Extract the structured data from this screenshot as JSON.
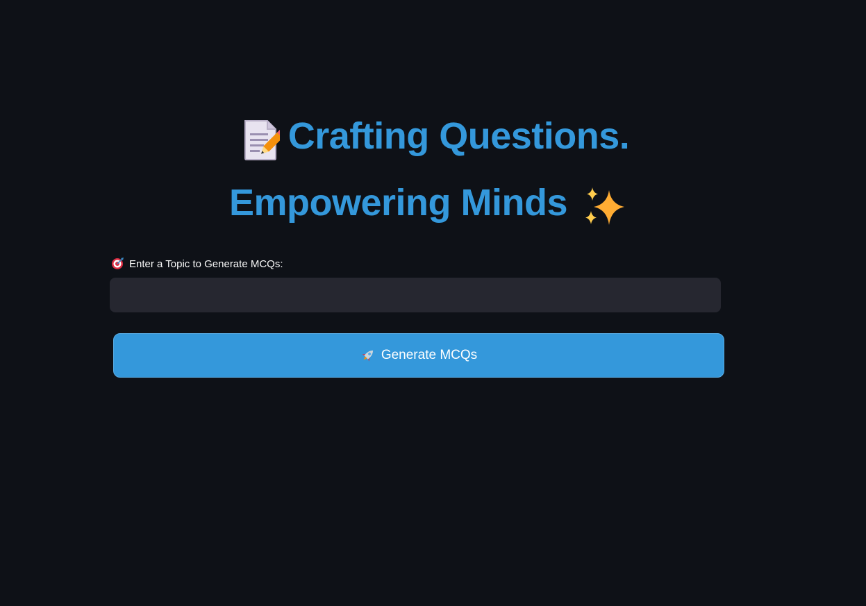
{
  "title": {
    "line1": "Crafting Questions.",
    "line2": "Empowering Minds",
    "line1_icon": "memo-icon",
    "line2_icon": "sparkles-icon",
    "color": "#3498db"
  },
  "topic_input": {
    "label": "Enter a Topic to Generate MCQs:",
    "label_icon": "target-icon",
    "value": "",
    "placeholder": ""
  },
  "generate_button": {
    "label": "Generate MCQs",
    "icon": "rocket-icon",
    "color": "#3498db"
  },
  "theme": {
    "background": "#0e1117",
    "input_background": "#262730"
  }
}
